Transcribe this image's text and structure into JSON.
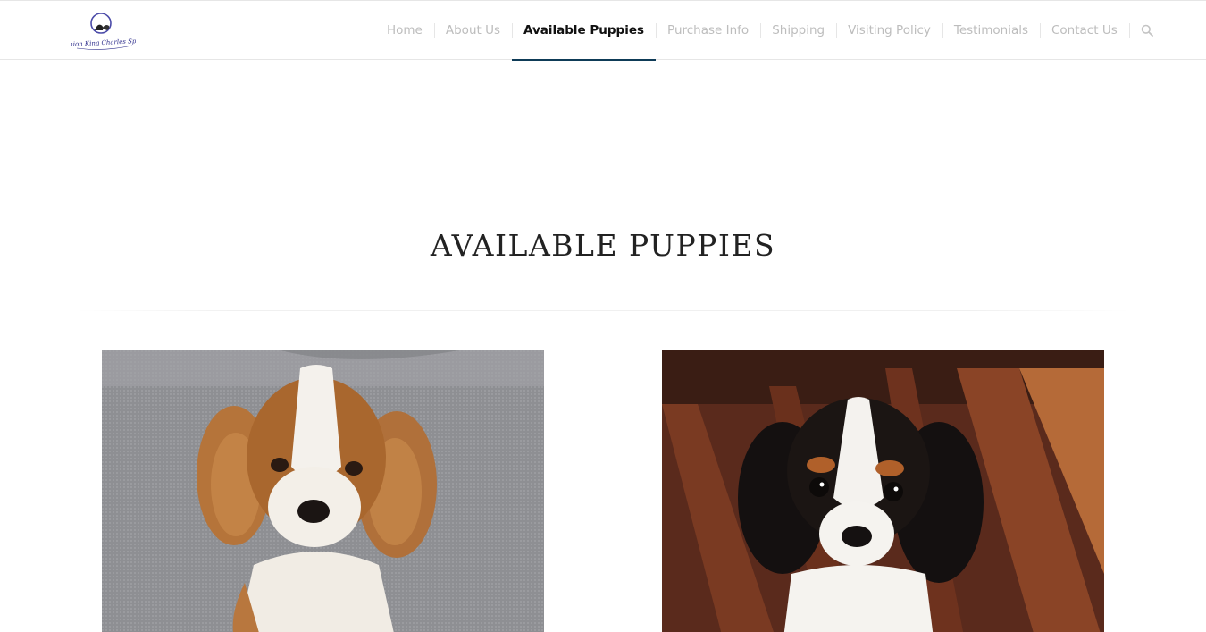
{
  "brand": {
    "logo_text": "Dominion King Charles Spaniels",
    "logo_color": "#2a2a8a"
  },
  "nav": {
    "items": [
      {
        "label": "Home",
        "active": false
      },
      {
        "label": "About Us",
        "active": false
      },
      {
        "label": "Available Puppies",
        "active": true
      },
      {
        "label": "Purchase Info",
        "active": false
      },
      {
        "label": "Shipping",
        "active": false
      },
      {
        "label": "Visiting Policy",
        "active": false
      },
      {
        "label": "Testimonials",
        "active": false
      },
      {
        "label": "Contact Us",
        "active": false
      }
    ],
    "search_icon": "search-icon",
    "accent_color": "#0e3b57"
  },
  "main": {
    "title": "AVAILABLE PUPPIES"
  },
  "puppies": [
    {
      "photo": "blenheim-puppy-on-gray-couch"
    },
    {
      "photo": "tricolor-puppy-on-wood-floor"
    }
  ]
}
